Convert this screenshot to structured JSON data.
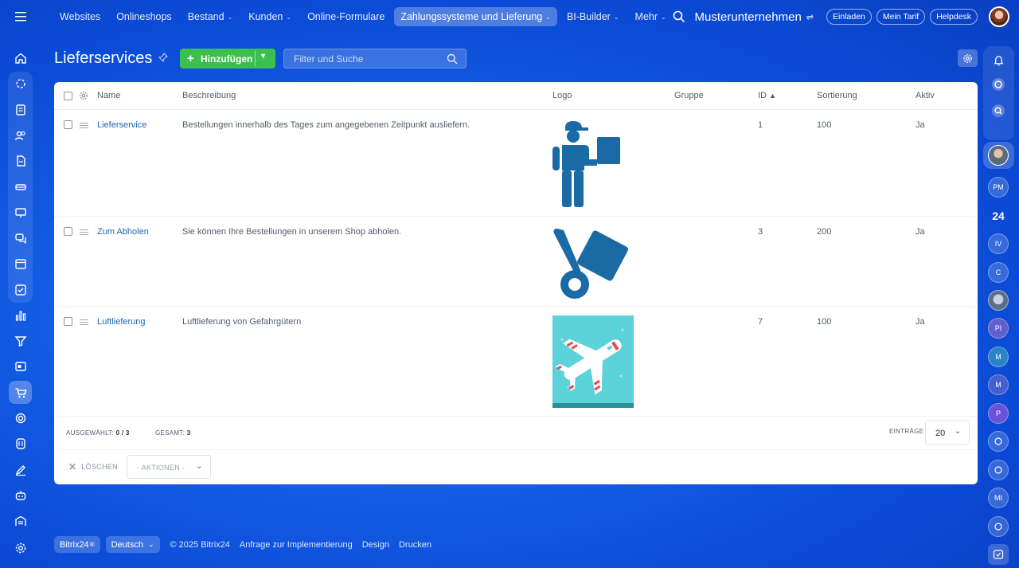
{
  "topnav": [
    {
      "label": "Websites",
      "dropdown": false,
      "active": false
    },
    {
      "label": "Onlineshops",
      "dropdown": false,
      "active": false
    },
    {
      "label": "Bestand",
      "dropdown": true,
      "active": false
    },
    {
      "label": "Kunden",
      "dropdown": true,
      "active": false
    },
    {
      "label": "Online-Formulare",
      "dropdown": false,
      "active": false
    },
    {
      "label": "Zahlungssysteme und Lieferung",
      "dropdown": true,
      "active": true
    },
    {
      "label": "BI-Builder",
      "dropdown": true,
      "active": false
    },
    {
      "label": "Mehr",
      "dropdown": true,
      "active": false
    }
  ],
  "header": {
    "company": "Musterunternehmen",
    "invite": "Einladen",
    "tariff": "Mein Tarif",
    "helpdesk": "Helpdesk"
  },
  "page": {
    "title": "Lieferservices",
    "add_label": "Hinzufügen",
    "filter_placeholder": "Filter und Suche"
  },
  "table": {
    "columns": {
      "name": "Name",
      "description": "Beschreibung",
      "logo": "Logo",
      "group": "Gruppe",
      "id": "ID",
      "sort": "Sortierung",
      "active": "Aktiv"
    },
    "rows": [
      {
        "name": "Lieferservice",
        "description": "Bestellungen innerhalb des Tages zum angegebenen Zeitpunkt ausliefern.",
        "group": "",
        "id": "1",
        "sort": "100",
        "active": "Ja",
        "logo": "delivery-person-icon"
      },
      {
        "name": "Zum Abholen",
        "description": "Sie können Ihre Bestellungen in unserem Shop abholen.",
        "group": "",
        "id": "3",
        "sort": "200",
        "active": "Ja",
        "logo": "hand-truck-icon"
      },
      {
        "name": "Luftlieferung",
        "description": "Luftlieferung von Gefahrgütern",
        "group": "",
        "id": "7",
        "sort": "100",
        "active": "Ja",
        "logo": "airplane-image"
      }
    ]
  },
  "footer": {
    "selected_label": "AUSGEWÄHLT:",
    "selected_value": "0 / 3",
    "total_label": "GESAMT:",
    "total_value": "3",
    "entries_label": "EINTRÄGE",
    "entries_value": "20",
    "delete_label": "LÖSCHEN",
    "actions_label": "- AKTIONEN -"
  },
  "bottom": {
    "brand": "Bitrix24",
    "language": "Deutsch",
    "copyright": "© 2025 Bitrix24",
    "impl": "Anfrage zur Implementierung",
    "design": "Design",
    "print": "Drucken"
  },
  "right_avatars": [
    "PM",
    "IV",
    "C",
    "PI",
    "M",
    "M",
    "P",
    "MI"
  ],
  "right_misc": {
    "b24": "24"
  },
  "colors": {
    "accent_green": "#3bc04f",
    "link": "#2067b0",
    "logo_blue": "#1a6aa6"
  }
}
